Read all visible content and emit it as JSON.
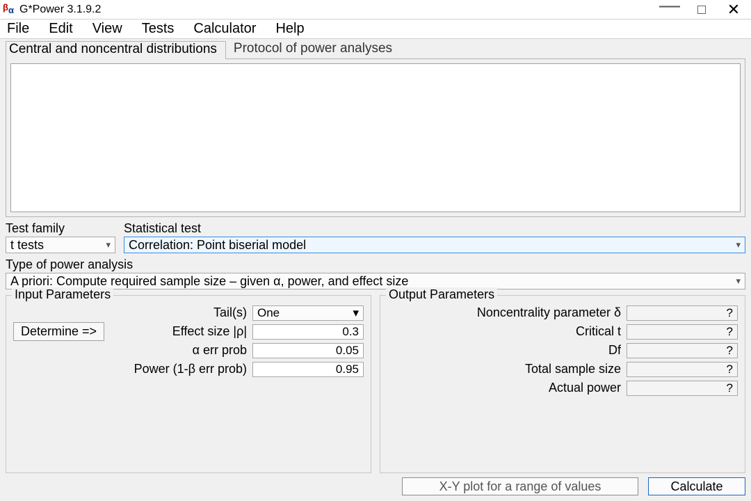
{
  "window": {
    "title": "G*Power 3.1.9.2"
  },
  "menu": {
    "file": "File",
    "edit": "Edit",
    "view": "View",
    "tests": "Tests",
    "calc": "Calculator",
    "help": "Help"
  },
  "tabs": {
    "central": "Central and noncentral distributions",
    "protocol": "Protocol of power analyses"
  },
  "selectors": {
    "test_family_label": "Test family",
    "test_family_value": "t tests",
    "stat_test_label": "Statistical test",
    "stat_test_value": "Correlation: Point biserial model",
    "analysis_type_label": "Type of power analysis",
    "analysis_type_value": "A priori: Compute required sample size – given α, power, and effect size"
  },
  "input": {
    "legend": "Input Parameters",
    "determine": "Determine =>",
    "tails_label": "Tail(s)",
    "tails_value": "One",
    "effect_label": "Effect size |ρ|",
    "effect_value": "0.3",
    "alpha_label": "α err prob",
    "alpha_value": "0.05",
    "power_label": "Power (1-β err prob)",
    "power_value": "0.95"
  },
  "output": {
    "legend": "Output Parameters",
    "ncp_label": "Noncentrality parameter δ",
    "ncp_value": "?",
    "crit_label": "Critical t",
    "crit_value": "?",
    "df_label": "Df",
    "df_value": "?",
    "n_label": "Total sample size",
    "n_value": "?",
    "actual_label": "Actual power",
    "actual_value": "?"
  },
  "buttons": {
    "xy": "X-Y plot for a range of values",
    "calc": "Calculate"
  }
}
